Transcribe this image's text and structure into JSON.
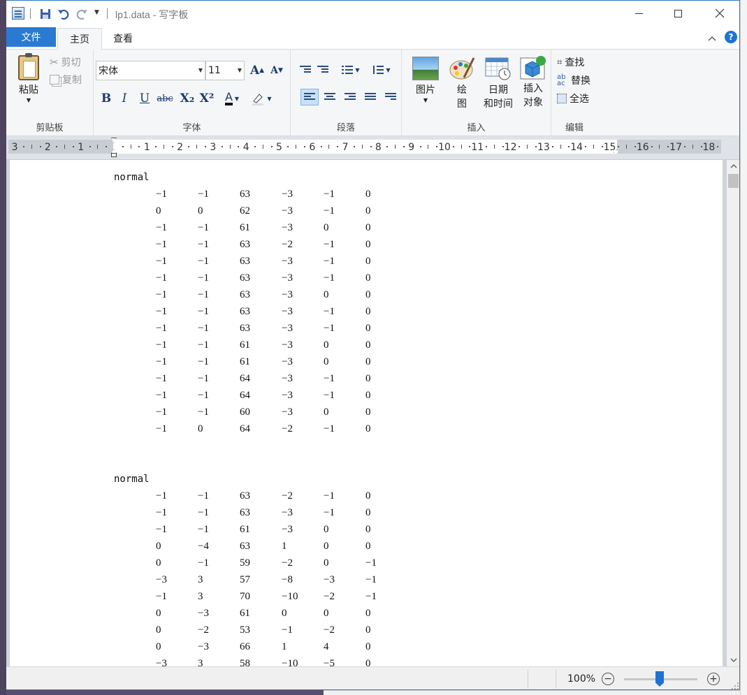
{
  "window": {
    "title": "lp1.data - 写字板"
  },
  "tabs": {
    "file": "文件",
    "home": "主页",
    "view": "查看",
    "help": "?"
  },
  "ribbon": {
    "clipboard": {
      "label": "剪贴板",
      "paste": "粘贴",
      "cut": "剪切",
      "copy": "复制"
    },
    "font": {
      "label": "字体",
      "family": "宋体",
      "size": "11",
      "bold": "B",
      "italic": "I",
      "underline": "U",
      "strike": "abc",
      "subscript": "X₂",
      "superscript": "X²",
      "color_letter": "A"
    },
    "paragraph": {
      "label": "段落"
    },
    "insert": {
      "label": "插入",
      "picture": "图片",
      "paint_line1": "绘",
      "paint_line2": "图",
      "datetime_line1": "日期",
      "datetime_line2": "和时间",
      "object_line1": "插入",
      "object_line2": "对象"
    },
    "editing": {
      "label": "编辑",
      "find": "查找",
      "replace": "替换",
      "select_all": "全选"
    }
  },
  "ruler": {
    "labels": [
      "3",
      "2",
      "1",
      "1",
      "2",
      "3",
      "4",
      "5",
      "6",
      "7",
      "8",
      "9",
      "10",
      "11",
      "12",
      "13",
      "14",
      "15",
      "16",
      "17",
      "18"
    ]
  },
  "document": {
    "sections": [
      {
        "title": "normal",
        "rows": [
          [
            "−1",
            "−1",
            "63",
            "−3",
            "−1",
            "0"
          ],
          [
            "0",
            "0",
            "62",
            "−3",
            "−1",
            "0"
          ],
          [
            "−1",
            "−1",
            "61",
            "−3",
            "0",
            "0"
          ],
          [
            "−1",
            "−1",
            "63",
            "−2",
            "−1",
            "0"
          ],
          [
            "−1",
            "−1",
            "63",
            "−3",
            "−1",
            "0"
          ],
          [
            "−1",
            "−1",
            "63",
            "−3",
            "−1",
            "0"
          ],
          [
            "−1",
            "−1",
            "63",
            "−3",
            "0",
            "0"
          ],
          [
            "−1",
            "−1",
            "63",
            "−3",
            "−1",
            "0"
          ],
          [
            "−1",
            "−1",
            "63",
            "−3",
            "−1",
            "0"
          ],
          [
            "−1",
            "−1",
            "61",
            "−3",
            "0",
            "0"
          ],
          [
            "−1",
            "−1",
            "61",
            "−3",
            "0",
            "0"
          ],
          [
            "−1",
            "−1",
            "64",
            "−3",
            "−1",
            "0"
          ],
          [
            "−1",
            "−1",
            "64",
            "−3",
            "−1",
            "0"
          ],
          [
            "−1",
            "−1",
            "60",
            "−3",
            "0",
            "0"
          ],
          [
            "−1",
            "0",
            "64",
            "−2",
            "−1",
            "0"
          ]
        ]
      },
      {
        "title": "normal",
        "rows": [
          [
            "−1",
            "−1",
            "63",
            "−2",
            "−1",
            "0"
          ],
          [
            "−1",
            "−1",
            "63",
            "−3",
            "−1",
            "0"
          ],
          [
            "−1",
            "−1",
            "61",
            "−3",
            "0",
            "0"
          ],
          [
            "0",
            "−4",
            "63",
            "1",
            "0",
            "0"
          ],
          [
            "0",
            "−1",
            "59",
            "−2",
            "0",
            "−1"
          ],
          [
            "−3",
            "3",
            "57",
            "−8",
            "−3",
            "−1"
          ],
          [
            "−1",
            "3",
            "70",
            "−10",
            "−2",
            "−1"
          ],
          [
            "0",
            "−3",
            "61",
            "0",
            "0",
            "0"
          ],
          [
            "0",
            "−2",
            "53",
            "−1",
            "−2",
            "0"
          ],
          [
            "0",
            "−3",
            "66",
            "1",
            "4",
            "0"
          ],
          [
            "−3",
            "3",
            "58",
            "−10",
            "−5",
            "0"
          ]
        ]
      }
    ]
  },
  "status": {
    "zoom": "100%"
  }
}
